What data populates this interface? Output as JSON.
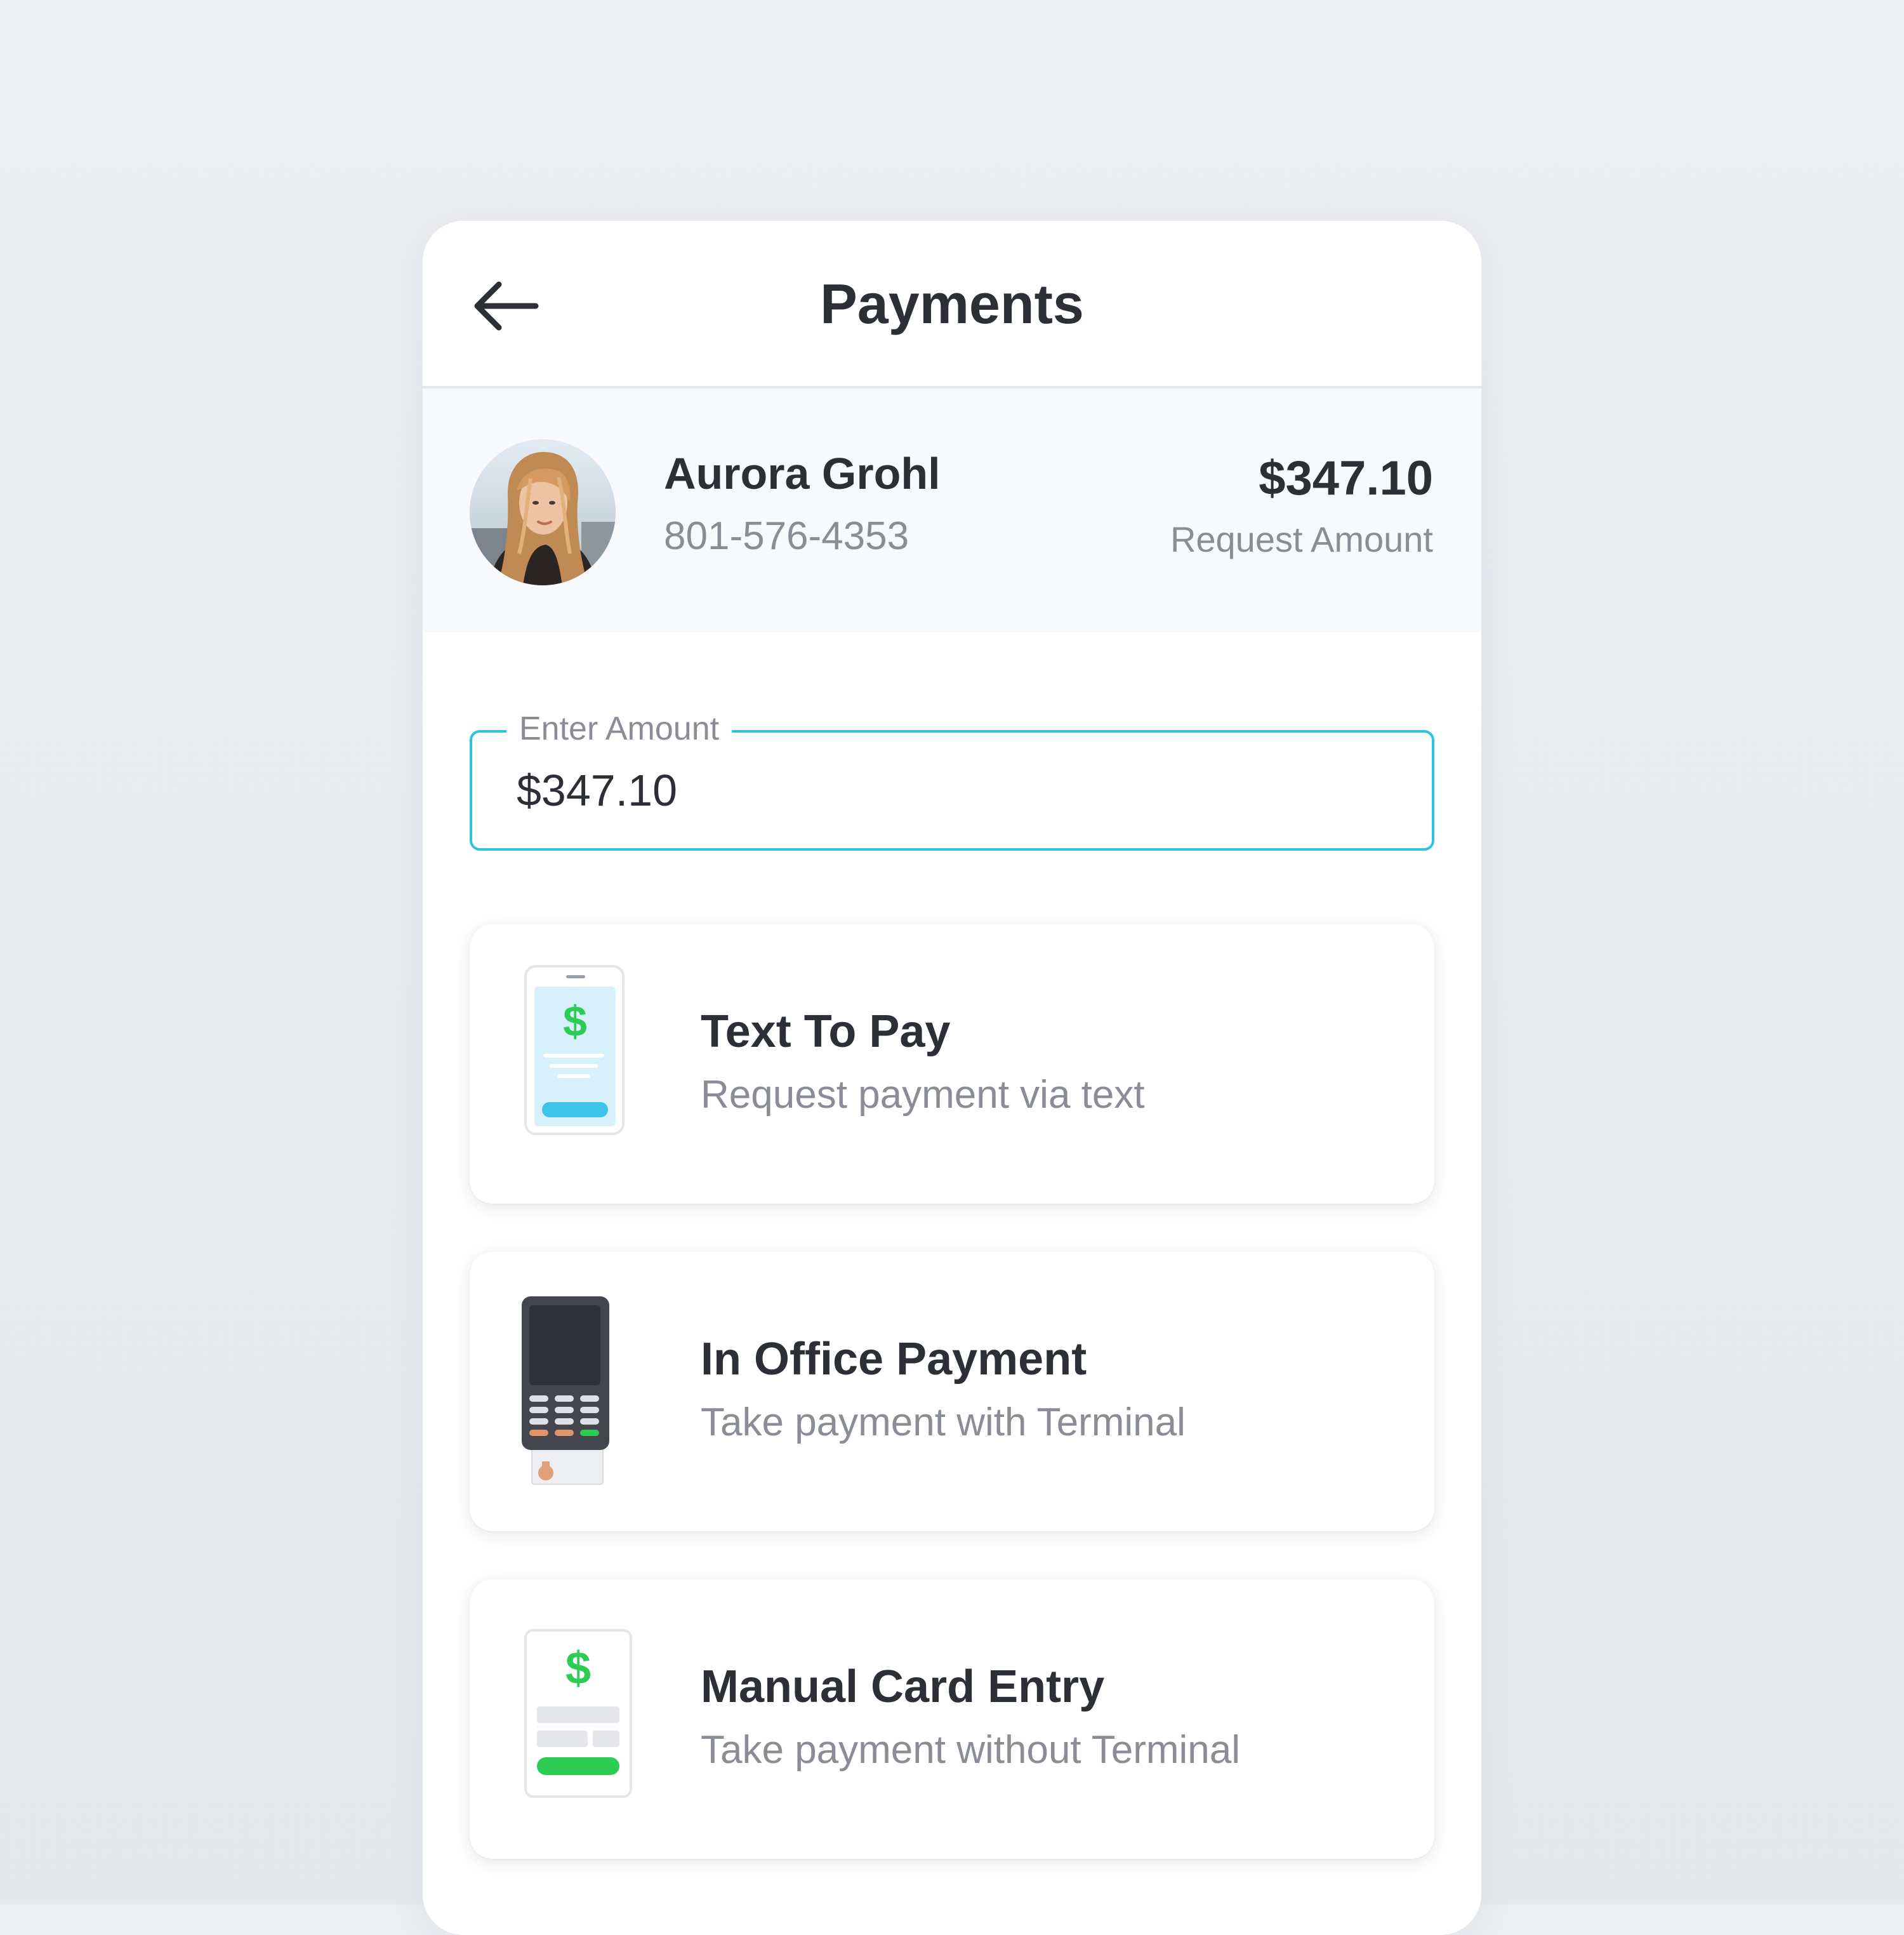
{
  "header": {
    "title": "Payments",
    "back_icon": "arrow-left-icon"
  },
  "customer": {
    "name": "Aurora Grohl",
    "phone": "801-576-4353",
    "amount": "$347.10",
    "amount_label": "Request Amount"
  },
  "amount_field": {
    "label": "Enter Amount",
    "value": "$347.10"
  },
  "options": [
    {
      "title": "Text To Pay",
      "subtitle": "Request payment via text",
      "icon": "phone-text-to-pay-icon"
    },
    {
      "title": "In Office Payment",
      "subtitle": "Take payment with Terminal",
      "icon": "card-terminal-icon"
    },
    {
      "title": "Manual Card Entry",
      "subtitle": "Take payment without Terminal",
      "icon": "manual-card-form-icon"
    }
  ],
  "colors": {
    "accent": "#2ec3e0",
    "success": "#2ecc55",
    "text_primary": "#2d2f36",
    "text_secondary": "#8a8d95",
    "background": "#eceef2"
  }
}
